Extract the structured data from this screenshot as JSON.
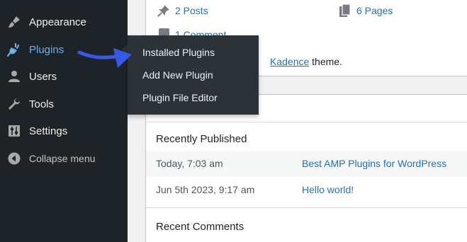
{
  "sidebar": {
    "items": [
      {
        "label": "Appearance",
        "icon": "paintbrush-icon"
      },
      {
        "label": "Plugins",
        "icon": "plugin-icon",
        "active": true
      },
      {
        "label": "Users",
        "icon": "users-icon"
      },
      {
        "label": "Tools",
        "icon": "wrench-icon"
      },
      {
        "label": "Settings",
        "icon": "sliders-icon"
      },
      {
        "label": "Collapse menu",
        "icon": "collapse-icon"
      }
    ]
  },
  "flyout": {
    "items": [
      "Installed Plugins",
      "Add New Plugin",
      "Plugin File Editor"
    ]
  },
  "glance": {
    "posts": "2 Posts",
    "pages": "6 Pages",
    "comments": "1 Comment",
    "theme_prefix": "",
    "theme_link": "Kadence",
    "theme_suffix": " theme."
  },
  "activity": {
    "recently_published_title": "Recently Published",
    "posts": [
      {
        "date": "Today, 7:03 am",
        "title": "Best AMP Plugins for WordPress"
      },
      {
        "date": "Jun 5th 2023, 9:17 am",
        "title": "Hello world!"
      }
    ],
    "recent_comments_title": "Recent Comments"
  },
  "colors": {
    "sidebar_bg": "#1d2327",
    "flyout_bg": "#2c3338",
    "active_text": "#72aee6",
    "link": "#2271b1",
    "arrow": "#3858e9"
  }
}
